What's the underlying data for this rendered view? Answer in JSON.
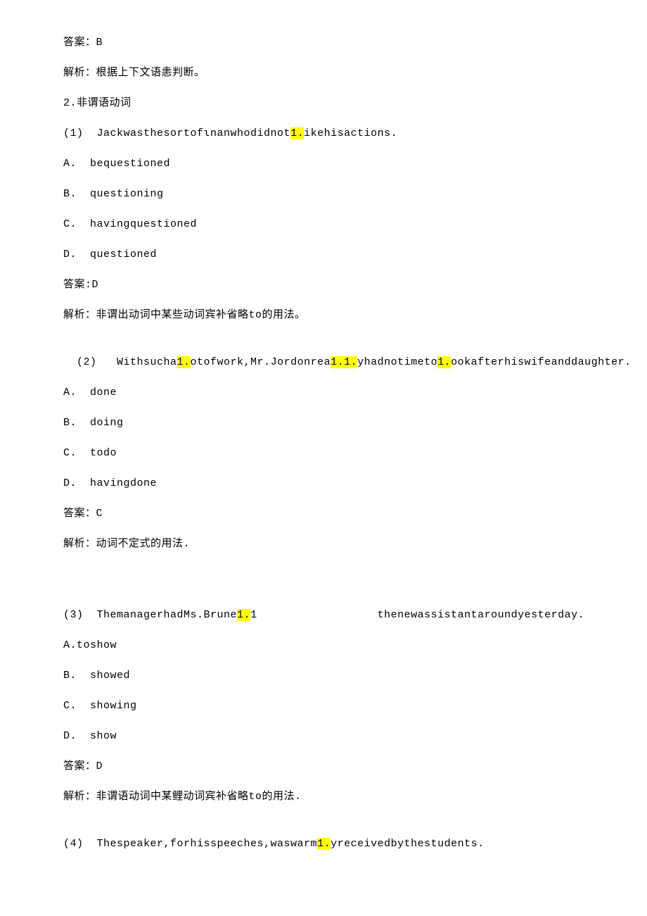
{
  "l1": "答案：B",
  "l2": "解析：根据上下文语恚判断。",
  "l3": "2.非谓语动词",
  "q1": {
    "pre": "(1)  Jackwasthesortofιnanwhodidnot",
    "hl": "1.",
    "post": "ikehisactions."
  },
  "q1a": "A.  bequestioned",
  "q1b": "B.  questioning",
  "q1c": "C.  havingquestioned",
  "q1d": "D.  questioned",
  "q1ans": "答案:D",
  "q1exp": "解析：非谓出动词中某些动词宾补省略to的用法。",
  "q2": {
    "pre": "  (2)   Withsucha",
    "hl1": "1.",
    "mid1": "otofwork,Mr.Jordonrea",
    "hl2": "1.1.",
    "mid2": "yhadnotimeto",
    "hl3": "1.",
    "post": "ookafterhiswifeanddaughter."
  },
  "q2a": "A.  done",
  "q2b": "B.  doing",
  "q2c": "C.  todo",
  "q2d": "D.  havingdone",
  "q2ans": "答案：C",
  "q2exp": "解析：动词不定式的用法.",
  "q3": {
    "pre": "(3)  ThemanagerhadMs.Brune",
    "hl": "1.",
    "mid": "1                  thenewassistantaroundyesterday."
  },
  "q3a": "A.toshow",
  "q3b": "B.  showed",
  "q3c": "C.  showing",
  "q3d": "D.  show",
  "q3ans": "答案：D",
  "q3exp": "解析：非谓语动词中某鲤动词宾补省略to的用法.",
  "q4": {
    "pre": "(4)  Thespeaker,forhisspeeches,waswarm",
    "hl": "1.",
    "post": "yreceivedbythestudents."
  }
}
